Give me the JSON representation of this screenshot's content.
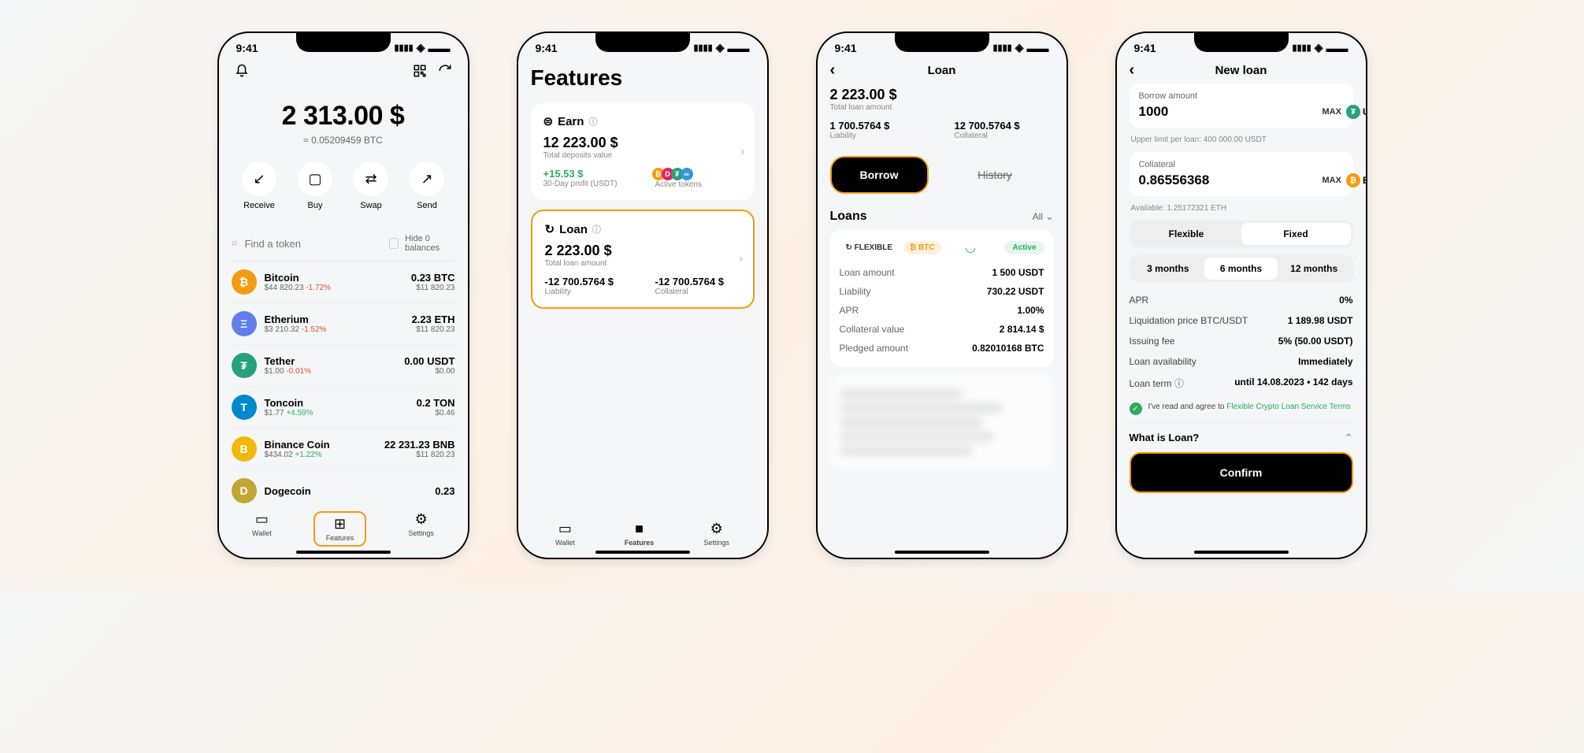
{
  "status_bar": {
    "time": "9:41"
  },
  "screen1": {
    "balance": "2 313.00 $",
    "balance_sub": "≈ 0.05209459 BTC",
    "actions": {
      "receive": "Receive",
      "buy": "Buy",
      "swap": "Swap",
      "send": "Send"
    },
    "search_placeholder": "Find a token",
    "hide_label": "Hide 0 balances",
    "tokens": [
      {
        "name": "Bitcoin",
        "sub_price": "$44 820.23",
        "sub_change": "-1.72%",
        "amt": "0.23 BTC",
        "usd": "$11 820.23",
        "color": "#f39c12",
        "sym": "₿",
        "change_neg": true
      },
      {
        "name": "Etherium",
        "sub_price": "$3 210.32",
        "sub_change": "-1.52%",
        "amt": "2.23 ETH",
        "usd": "$11 820.23",
        "color": "#627eea",
        "sym": "Ξ",
        "change_neg": true
      },
      {
        "name": "Tether",
        "sub_price": "$1.00",
        "sub_change": "-0.01%",
        "amt": "0.00 USDT",
        "usd": "$0.00",
        "color": "#26a17b",
        "sym": "₮",
        "change_neg": true
      },
      {
        "name": "Toncoin",
        "sub_price": "$1.77",
        "sub_change": "+4.59%",
        "amt": "0.2 TON",
        "usd": "$0.46",
        "color": "#0088cc",
        "sym": "T",
        "change_neg": false
      },
      {
        "name": "Binance Coin",
        "sub_price": "$434.02",
        "sub_change": "+1.22%",
        "amt": "22 231.23 BNB",
        "usd": "$11 820.23",
        "color": "#f0b90b",
        "sym": "B",
        "change_neg": false
      },
      {
        "name": "Dogecoin",
        "sub_price": "",
        "sub_change": "",
        "amt": "0.23",
        "usd": "",
        "color": "#c2a633",
        "sym": "D",
        "change_neg": false
      }
    ],
    "nav": {
      "wallet": "Wallet",
      "features": "Features",
      "settings": "Settings"
    }
  },
  "screen2": {
    "title": "Features",
    "earn": {
      "title": "Earn",
      "value": "12 223.00 $",
      "sub": "Total deposits value",
      "profit": "+15.53 $",
      "profit_sub": "30-Day profit (USDT)",
      "active_tokens": "Active tokens"
    },
    "loan": {
      "title": "Loan",
      "value": "2 223.00 $",
      "sub": "Total loan amount",
      "liability": "-12 700.5764 $",
      "liability_label": "Liability",
      "collateral": "-12 700.5764 $",
      "collateral_label": "Collateral"
    }
  },
  "screen3": {
    "title": "Loan",
    "total": "2 223.00 $",
    "total_label": "Total loan amount",
    "liability": "1 700.5764 $",
    "liability_label": "Liability",
    "collateral": "12 700.5764 $",
    "collateral_label": "Collateral",
    "borrow_btn": "Borrow",
    "history_link": "History",
    "loans_title": "Loans",
    "filter": "All",
    "loan": {
      "tag_flexible": "FLEXIBLE",
      "tag_btc": "BTC",
      "tag_active": "Active",
      "rows": [
        {
          "label": "Loan amount",
          "val": "1 500 USDT"
        },
        {
          "label": "Liability",
          "val": "730.22 USDT"
        },
        {
          "label": "APR",
          "val": "1.00%"
        },
        {
          "label": "Collateral value",
          "val": "2 814.14 $"
        },
        {
          "label": "Pledged amount",
          "val": "0.82010168 BTC"
        }
      ]
    }
  },
  "screen4": {
    "title": "New loan",
    "borrow_label": "Borrow amount",
    "borrow_value": "1000",
    "borrow_currency": "USDT",
    "borrow_hint": "Upper limit per loan: 400 000.00 USDT",
    "collateral_label": "Collateral",
    "collateral_value": "0.86556368",
    "collateral_currency": "BTC",
    "collateral_hint": "Available: 1.25172321 ETH",
    "max": "MAX",
    "flexible": "Flexible",
    "fixed": "Fixed",
    "terms": [
      "3 months",
      "6 months",
      "12 months"
    ],
    "summary": [
      {
        "label": "APR",
        "val": "0%"
      },
      {
        "label": "Liquidation price BTC/USDT",
        "val": "1 189.98 USDT"
      },
      {
        "label": "Issuing fee",
        "val": "5% (50.00 USDT)"
      },
      {
        "label": "Loan availability",
        "val": "Immediately"
      },
      {
        "label": "Loan term ⓘ",
        "val": "until 14.08.2023 • 142 days"
      }
    ],
    "agree_text": "I've read and agree to ",
    "agree_link": "Flexible Crypto Loan Service Terms",
    "what_is": "What is Loan?",
    "confirm": "Confirm"
  }
}
